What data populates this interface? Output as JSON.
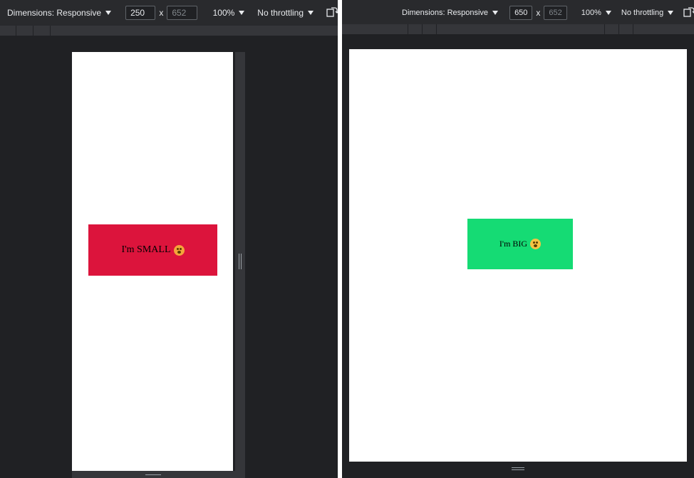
{
  "left": {
    "toolbar": {
      "dimensions_label": "Dimensions: Responsive",
      "width": "250",
      "times": "x",
      "height": "652",
      "zoom": "100%",
      "throttling": "No throttling"
    },
    "box": {
      "text": "I'm SMALL",
      "color": "#dc143c",
      "emoji": "flushed-face-icon"
    }
  },
  "right": {
    "toolbar": {
      "dimensions_label": "Dimensions: Responsive",
      "width": "650",
      "times": "x",
      "height": "652",
      "zoom": "100%",
      "throttling": "No throttling"
    },
    "box": {
      "text": "I'm BIG",
      "color": "#15db74",
      "emoji": "screaming-face-icon"
    }
  }
}
